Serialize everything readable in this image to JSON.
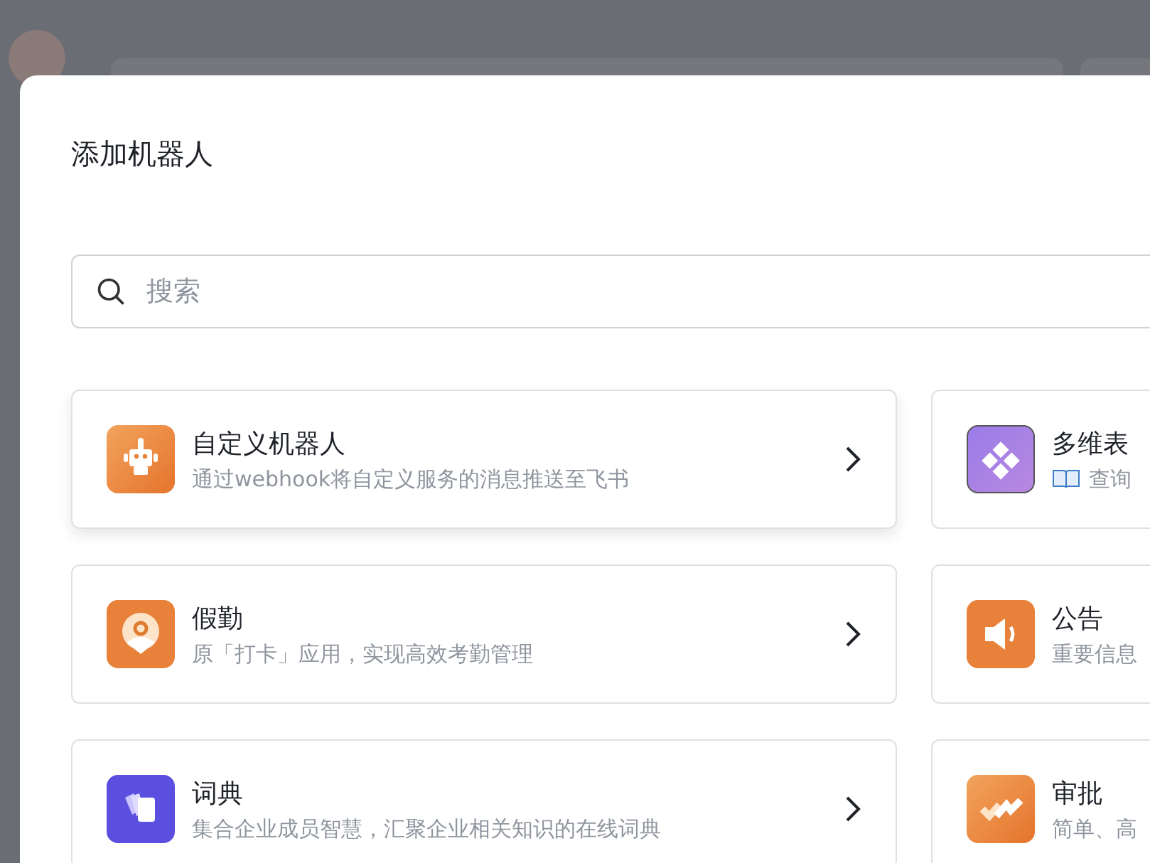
{
  "dialog": {
    "title": "添加机器人",
    "search": {
      "placeholder": "搜索"
    },
    "bots": [
      {
        "kind": "robot",
        "name": "自定义机器人",
        "description": "通过webhook将自定义服务的消息推送至飞书",
        "hovered": true
      },
      {
        "kind": "table",
        "name": "多维表",
        "description": "查询",
        "hovered": false
      },
      {
        "kind": "attendance",
        "name": "假勤",
        "description": "原「打卡」应用，实现高效考勤管理",
        "hovered": false
      },
      {
        "kind": "notice",
        "name": "公告",
        "description": "重要信息",
        "hovered": false
      },
      {
        "kind": "dictionary",
        "name": "词典",
        "description": "集合企业成员智慧，汇聚企业相关知识的在线词典",
        "hovered": false
      },
      {
        "kind": "approval",
        "name": "审批",
        "description": "简单、高",
        "hovered": false
      }
    ]
  }
}
